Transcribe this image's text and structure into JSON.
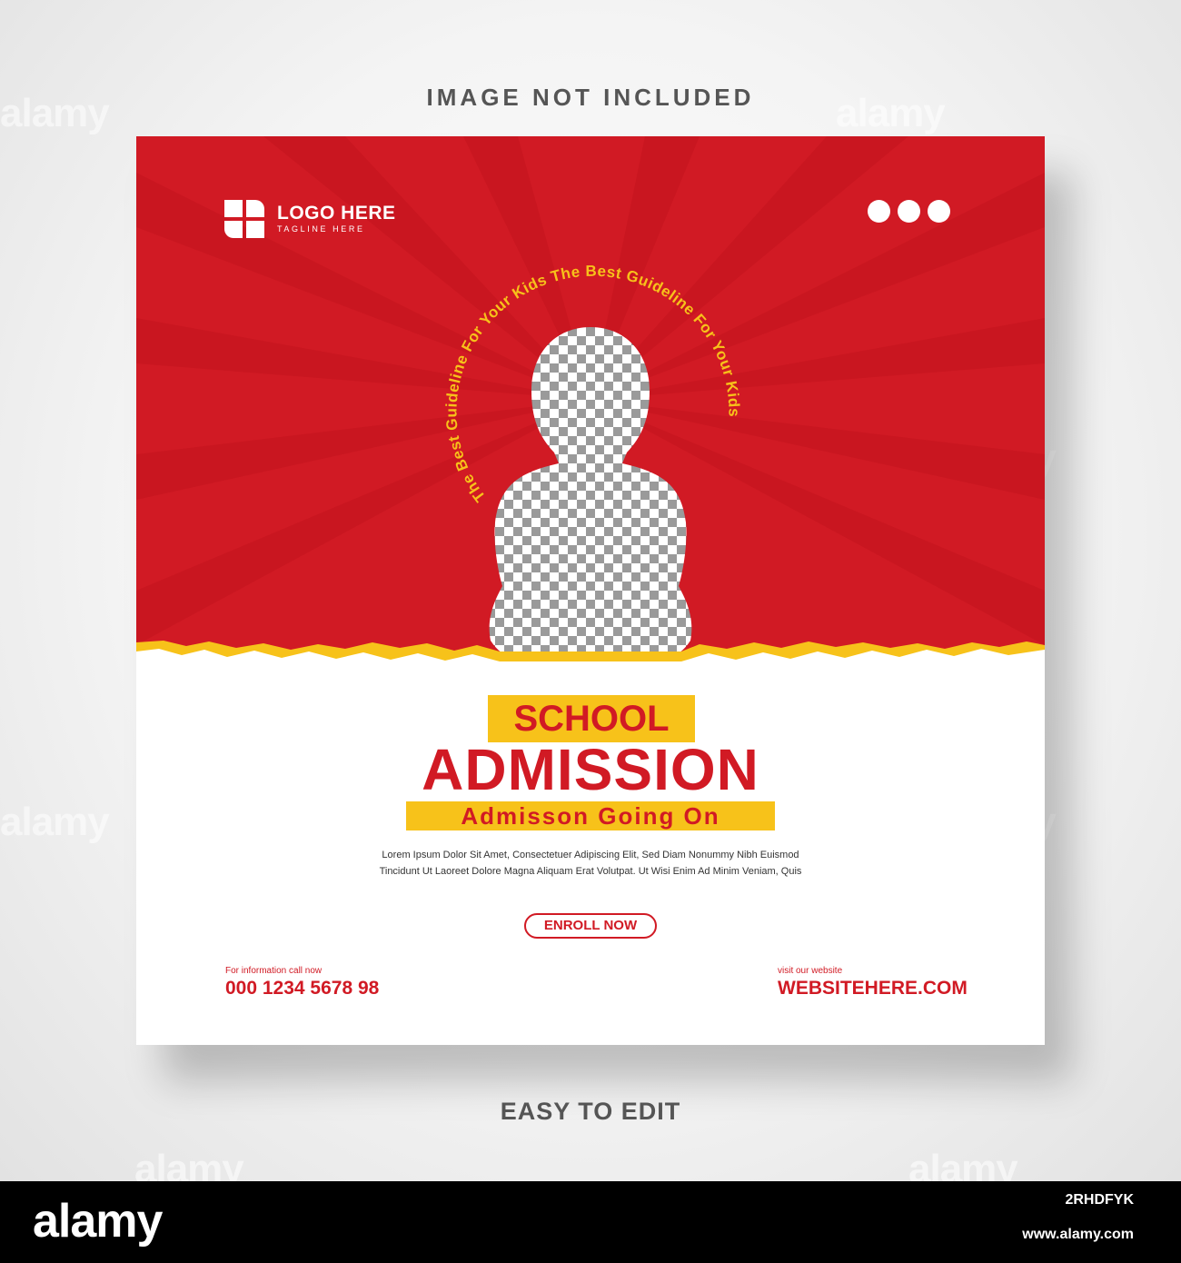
{
  "captions": {
    "top": "IMAGE NOT INCLUDED",
    "bottom": "EASY TO EDIT"
  },
  "watermark": {
    "text": "alamy",
    "small_text": "a"
  },
  "colors": {
    "brand_red": "#d11a24",
    "accent_yellow": "#f7c21a",
    "card_white": "#ffffff",
    "placeholder_gray": "#9a9a9a"
  },
  "post": {
    "logo": {
      "title": "LOGO HERE",
      "tagline": "TAGLINE HERE",
      "icon": "logo-mark-icon"
    },
    "menu_icon": "more-dots-icon",
    "arc_text": "The Best Guideline For Your Kids The Best Guideline For Your Kids",
    "photo_placeholder_icon": "person-silhouette-icon",
    "headline_small": "SCHOOL",
    "headline_big": "ADMISSION",
    "subheadline": "Admisson Going On",
    "body_line1": "Lorem Ipsum Dolor Sit Amet, Consectetuer Adipiscing Elit, Sed Diam Nonummy Nibh Euismod",
    "body_line2": "Tincidunt Ut Laoreet Dolore Magna Aliquam Erat Volutpat. Ut Wisi Enim Ad Minim Veniam, Quis",
    "cta_label": "ENROLL NOW",
    "contact_left_label": "For information call now",
    "contact_left_value": "000 1234 5678 98",
    "contact_right_label": "visit our website",
    "contact_right_value": "WEBSITEHERE.COM"
  },
  "stock_bar": {
    "logo": "alamy",
    "image_id": "2RHDFYK",
    "url": "www.alamy.com"
  }
}
